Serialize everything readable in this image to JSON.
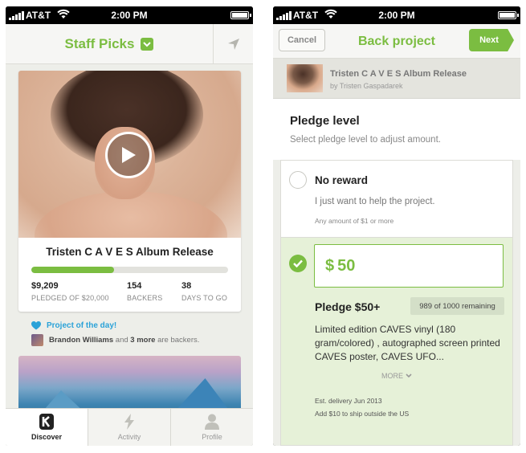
{
  "left_phone": {
    "status": {
      "carrier": "AT&T",
      "time": "2:00 PM"
    },
    "nav": {
      "title": "Staff Picks"
    },
    "project": {
      "title": "Tristen C A V E S Album Release",
      "progress": 0.42,
      "stats": [
        {
          "value": "$9,209",
          "label": "PLEDGED OF $20,000"
        },
        {
          "value": "154",
          "label": "BACKERS"
        },
        {
          "value": "38",
          "label": "DAYS TO GO"
        }
      ]
    },
    "project_of_day": "Project of the day!",
    "backers_line": {
      "name": "Brandon Williams",
      "mid": "and",
      "more": "3 more",
      "tail": "are backers."
    },
    "tabs": [
      {
        "label": "Discover",
        "icon": "kickstarter-k-icon"
      },
      {
        "label": "Activity",
        "icon": "lightning-icon"
      },
      {
        "label": "Profile",
        "icon": "person-icon"
      }
    ]
  },
  "right_phone": {
    "status": {
      "carrier": "AT&T",
      "time": "2:00 PM"
    },
    "nav": {
      "cancel": "Cancel",
      "title": "Back project",
      "next": "Next"
    },
    "project": {
      "title": "Tristen C A V E S Album Release",
      "by": "by Tristen Gaspadarek"
    },
    "pledge_level": {
      "heading": "Pledge level",
      "subheading": "Select pledge level to adjust amount."
    },
    "no_reward": {
      "title": "No reward",
      "desc": "I just want to help the project.",
      "min": "Any amount of $1 or more"
    },
    "selected": {
      "currency": "$",
      "amount": "50",
      "title": "Pledge $50+",
      "remaining": "989 of 1000 remaining",
      "desc": "Limited edition CAVES vinyl (180 gram/colored) , autographed screen printed CAVES poster, CAVES UFO...",
      "more": "MORE",
      "delivery": "Est. delivery Jun 2013",
      "shipping": "Add $10 to ship outside the US"
    }
  },
  "colors": {
    "accent_green": "#7bbd41",
    "link_blue": "#2aa2d8",
    "selected_bg": "#e6f1d8"
  }
}
